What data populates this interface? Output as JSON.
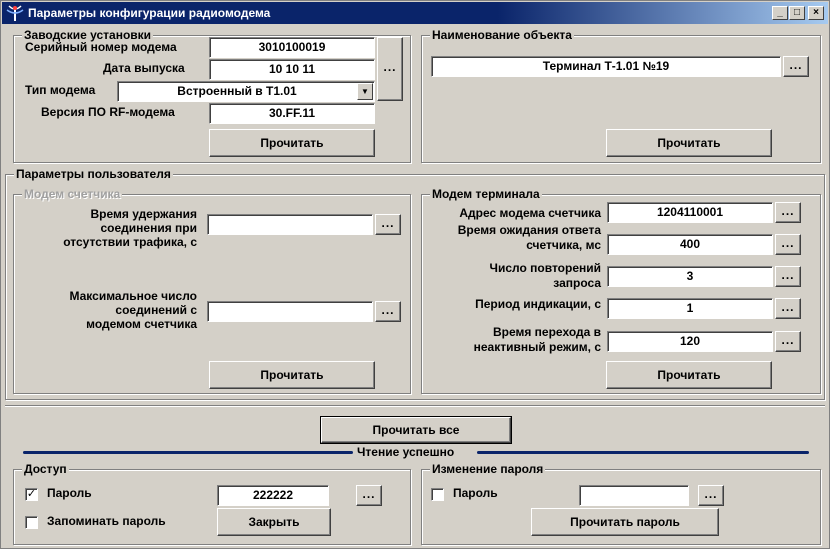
{
  "window": {
    "title": "Параметры конфигурации радиомодема",
    "minimize": "_",
    "maximize": "□",
    "close": "×"
  },
  "factory": {
    "legend": "Заводские установки",
    "serial_label": "Серийный номер модема",
    "serial_value": "3010100019",
    "date_label": "Дата выпуска",
    "date_value": "10 10 11",
    "modem_type_label": "Тип модема",
    "modem_type_value": "Встроенный в Т1.01",
    "fw_label": "Версия ПО RF-модема",
    "fw_value": "30.FF.11",
    "dots": "...",
    "read_button": "Прочитать"
  },
  "object": {
    "legend": "Наименование объекта",
    "name_value": "Терминал Т-1.01 №19",
    "dots": "...",
    "read_button": "Прочитать"
  },
  "user_params": {
    "legend": "Параметры пользователя",
    "meter_modem": {
      "legend": "Модем счетчика",
      "hold_label_1": "Время удержания",
      "hold_label_2": "соединения при",
      "hold_label_3": "отсутствии трафика, с",
      "hold_value": "",
      "max_label_1": "Максимальное число",
      "max_label_2": "соединений с",
      "max_label_3": "модемом счетчика",
      "max_value": "",
      "dots": "...",
      "read_button": "Прочитать"
    },
    "terminal_modem": {
      "legend": "Модем терминала",
      "addr_label": "Адрес модема счетчика",
      "addr_value": "1204110001",
      "wait_label_1": "Время ожидания ответа",
      "wait_label_2": "счетчика, мс",
      "wait_value": "400",
      "retry_label_1": "Число повторений",
      "retry_label_2": "запроса",
      "retry_value": "3",
      "period_label": "Период индикации, с",
      "period_value": "1",
      "inactive_label_1": "Время перехода в",
      "inactive_label_2": "неактивный режим, с",
      "inactive_value": "120",
      "dots": "...",
      "read_button": "Прочитать"
    }
  },
  "read_all_button": "Прочитать все",
  "status_text": "Чтение успешно",
  "access": {
    "legend": "Доступ",
    "password_label": "Пароль",
    "password_checked": true,
    "password_value": "222222",
    "remember_label": "Запоминать пароль",
    "remember_checked": false,
    "dots": "...",
    "close_button": "Закрыть"
  },
  "change_password": {
    "legend": "Изменение пароля",
    "password_label": "Пароль",
    "password_checked": false,
    "password_value": "",
    "dots": "...",
    "read_password_button": "Прочитать пароль"
  },
  "check_mark": "✓",
  "colors": {
    "titlebar": "#0a246a",
    "face": "#d4d0c8",
    "disabled_text": "#a0a0a0"
  }
}
